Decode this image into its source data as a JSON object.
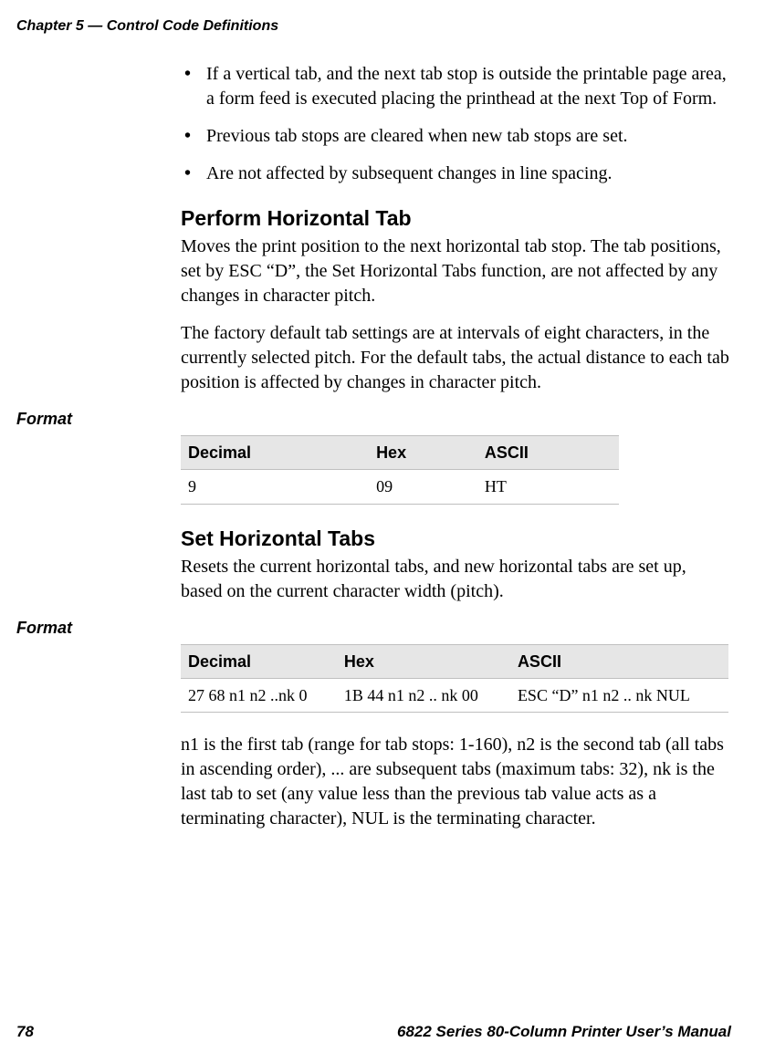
{
  "header": {
    "chapter_line": "Chapter 5 — Control Code Definitions"
  },
  "bullets": {
    "b1": "If a vertical tab, and the next tab stop is outside the printable page area, a form feed is executed placing the printhead at the next Top of Form.",
    "b2": "Previous tab stops are cleared when new tab stops are set.",
    "b3": "Are not affected by subsequent changes in line spacing."
  },
  "sections": {
    "perform_ht": {
      "title": "Perform Horizontal Tab",
      "p1": "Moves the print position to the next horizontal tab stop. The tab positions, set by ESC “D”, the Set Horizontal Tabs function, are not affected by any changes in character pitch.",
      "p2": "The factory default tab settings are at intervals of eight characters, in the currently selected pitch. For the default tabs, the actual distance to each tab position is affected by changes in character pitch."
    },
    "set_ht": {
      "title": "Set Horizontal Tabs",
      "p1": "Resets the current horizontal tabs, and new horizontal tabs are set up, based on the current character width (pitch).",
      "p2": "n1 is the first tab (range for tab stops: 1-160), n2 is the second tab (all tabs in ascending order), ... are subsequent tabs (maximum tabs: 32), nk is the last tab to set (any value less than the previous tab value acts as a terminating character), NUL is the terminating character."
    }
  },
  "labels": {
    "format": "Format"
  },
  "tables": {
    "headers": {
      "dec": "Decimal",
      "hex": "Hex",
      "ascii": "ASCII"
    },
    "t1": {
      "dec": "9",
      "hex": "09",
      "ascii": "HT"
    },
    "t2": {
      "dec": "27 68 n1 n2 ..nk 0",
      "hex": "1B 44 n1 n2 .. nk 00",
      "ascii": "ESC “D” n1 n2 .. nk NUL"
    }
  },
  "chart_data": [
    {
      "type": "table",
      "title": "Format",
      "headers": [
        "Decimal",
        "Hex",
        "ASCII"
      ],
      "rows": [
        [
          "9",
          "09",
          "HT"
        ]
      ]
    },
    {
      "type": "table",
      "title": "Format",
      "headers": [
        "Decimal",
        "Hex",
        "ASCII"
      ],
      "rows": [
        [
          "27 68 n1 n2 ..nk 0",
          "1B 44 n1 n2 .. nk 00",
          "ESC “D” n1 n2 .. nk NUL"
        ]
      ]
    }
  ],
  "footer": {
    "page": "78",
    "manual": "6822 Series 80-Column Printer User’s Manual"
  }
}
